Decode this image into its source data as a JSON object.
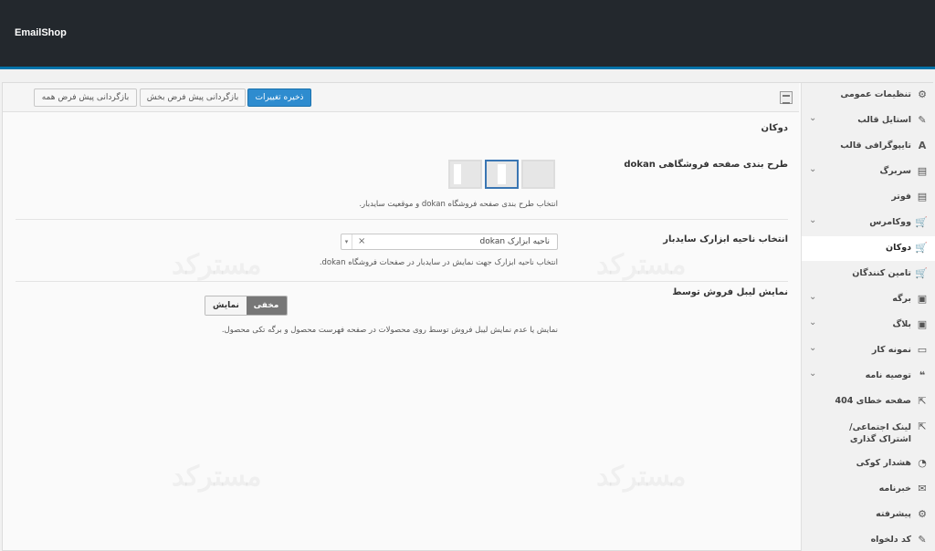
{
  "header": {
    "brand": "EmailShop"
  },
  "toolbar": {
    "save_label": "ذخیره تغییرات",
    "reset_section_label": "بازگردانی پیش فرض بخش",
    "reset_all_label": "بازگردانی پیش فرض همه"
  },
  "sidebar": {
    "items": [
      {
        "label": "تنظیمات عمومی",
        "icon": "gear-icon",
        "arrow": false
      },
      {
        "label": "استایل قالب",
        "icon": "brush-icon",
        "arrow": true
      },
      {
        "label": "تایپوگرافی قالب",
        "icon": "font-icon",
        "arrow": false
      },
      {
        "label": "سربرگ",
        "icon": "header-icon",
        "arrow": true
      },
      {
        "label": "فوتر",
        "icon": "footer-icon",
        "arrow": false
      },
      {
        "label": "ووکامرس",
        "icon": "cart-icon",
        "arrow": true
      },
      {
        "label": "دوکان",
        "icon": "cart-icon",
        "arrow": false,
        "active": true
      },
      {
        "label": "تامین کنندگان",
        "icon": "cart-icon",
        "arrow": false
      },
      {
        "label": "برگه",
        "icon": "page-icon",
        "arrow": true
      },
      {
        "label": "بلاگ",
        "icon": "blog-icon",
        "arrow": true
      },
      {
        "label": "نمونه کار",
        "icon": "portfolio-icon",
        "arrow": true
      },
      {
        "label": "توصیه نامه",
        "icon": "quote-icon",
        "arrow": true
      },
      {
        "label": "صفحه خطای 404",
        "icon": "share-icon",
        "arrow": false
      },
      {
        "label": "لینک اجتماعی/ اشتراک گذاری",
        "label2": "اشتراک گذاری",
        "icon": "share-icon",
        "arrow": false
      },
      {
        "label": "هشدار کوکی",
        "icon": "cookie-icon",
        "arrow": false
      },
      {
        "label": "خبرنامه",
        "icon": "mail-icon",
        "arrow": false
      },
      {
        "label": "پیشرفته",
        "icon": "gears-icon",
        "arrow": false
      },
      {
        "label": "کد دلخواه",
        "icon": "edit-icon",
        "arrow": false
      }
    ]
  },
  "content": {
    "section_title": "دوکان",
    "layout": {
      "label": "طرح بندی صفحه فروشگاهی dokan",
      "desc": "انتخاب طرح بندی صفحه فروشگاه dokan و موقعیت سایدبار."
    },
    "sidebar_area": {
      "label": "انتخاب ناحیه ابزارک سایدبار",
      "value": "ناحیه ابزارک dokan",
      "clear": "×",
      "desc": "انتخاب ناحیه ابزارک جهت نمایش در سایدبار در صفحات فروشگاه dokan."
    },
    "sale_label": {
      "label": "نمایش لیبل فروش توسط",
      "hide": "مخفی",
      "show": "نمایش",
      "desc": "نمایش یا عدم نمایش لیبل فروش توسط روی محصولات در صفحه فهرست محصول و برگه تکی محصول."
    }
  },
  "watermark": "مسترکد"
}
